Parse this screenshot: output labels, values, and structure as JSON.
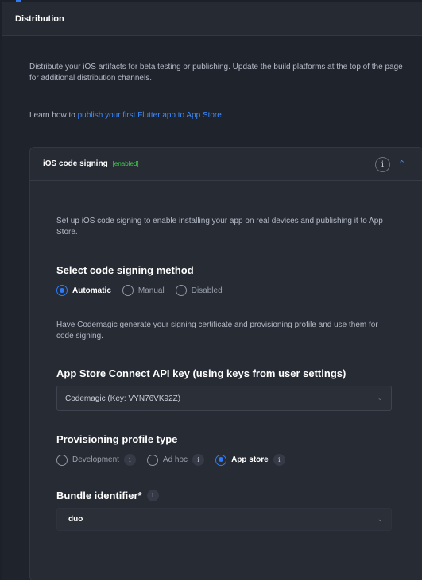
{
  "panel": {
    "title": "Distribution"
  },
  "intro": {
    "description": "Distribute your iOS artifacts for beta testing or publishing. Update the build platforms at the top of the page for additional distribution channels.",
    "learn_prefix": "Learn how to ",
    "learn_link": "publish your first Flutter app to App Store",
    "learn_suffix": "."
  },
  "signing_card": {
    "title": "iOS code signing",
    "badge": "[enabled]",
    "badge_color": "#3ecf4a",
    "info_icon": "info-icon",
    "collapse_icon": "chevron-up-icon",
    "description": "Set up iOS code signing to enable installing your app on real devices and publishing it to App Store.",
    "method": {
      "heading": "Select code signing method",
      "options": [
        "Automatic",
        "Manual",
        "Disabled"
      ],
      "selected": "Automatic",
      "help": "Have Codemagic generate your signing certificate and provisioning profile and use them for code signing."
    },
    "api_key": {
      "heading": "App Store Connect API key (using keys from user settings)",
      "value": "Codemagic (Key: VYN76VK92Z)"
    },
    "profile": {
      "heading": "Provisioning profile type",
      "options": [
        "Development",
        "Ad hoc",
        "App store"
      ],
      "selected": "App store"
    },
    "bundle": {
      "heading": "Bundle identifier*",
      "value": "duo"
    }
  },
  "colors": {
    "accent": "#2f7bf5",
    "link": "#3d8bff",
    "background": "#1c2029"
  }
}
